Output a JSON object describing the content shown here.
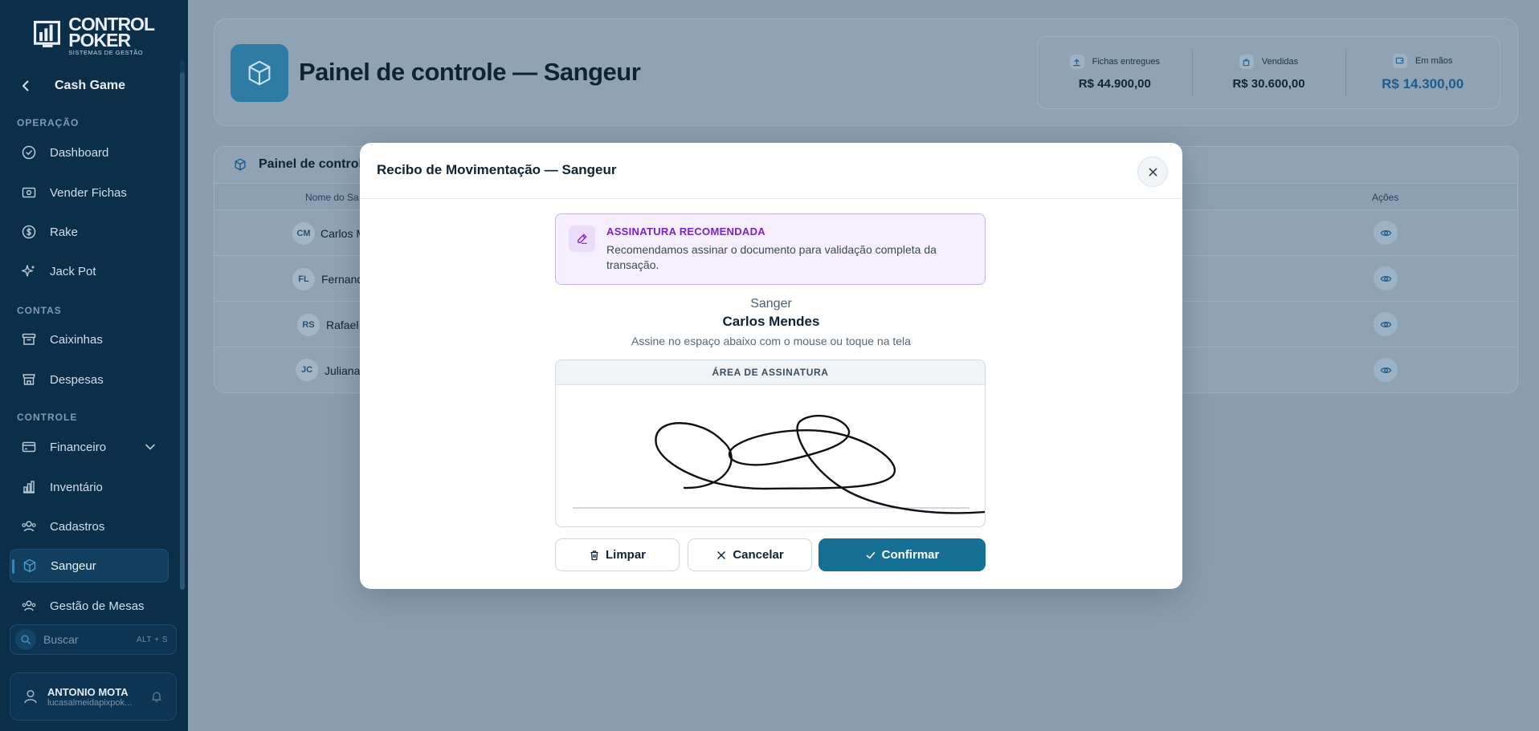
{
  "app": {
    "logo_line1": "CONTROL",
    "logo_line2": "POKER",
    "logo_line3": "SISTEMAS DE GESTÃO",
    "back_title": "Cash Game"
  },
  "sidebar": {
    "sections": {
      "operacao": "OPERAÇÃO",
      "contas": "CONTAS",
      "controle": "CONTROLE"
    },
    "items": [
      {
        "label": "Dashboard",
        "icon": "check-circle-icon"
      },
      {
        "label": "Vender Fichas",
        "icon": "cash-icon"
      },
      {
        "label": "Rake",
        "icon": "dollar-circle-icon"
      },
      {
        "label": "Jack Pot",
        "icon": "sparkles-icon"
      },
      {
        "label": "Caixinhas",
        "icon": "archive-icon"
      },
      {
        "label": "Despesas",
        "icon": "store-icon"
      },
      {
        "label": "Financeiro",
        "icon": "wallet-icon"
      },
      {
        "label": "Inventário",
        "icon": "bar-chart-icon"
      },
      {
        "label": "Cadastros",
        "icon": "users-icon"
      },
      {
        "label": "Sangeur",
        "icon": "cube-icon"
      },
      {
        "label": "Gestão de Mesas",
        "icon": "users-group-icon"
      }
    ],
    "active_item": "Sangeur",
    "search": {
      "placeholder": "Buscar",
      "shortcut": "ALT + S"
    },
    "user": {
      "name": "ANTONIO MOTA",
      "email": "lucasalmeidapixpok..."
    }
  },
  "page": {
    "title": "Painel de controle — Sangeur",
    "stats": [
      {
        "label": "Fichas entregues",
        "value": "R$ 44.900,00"
      },
      {
        "label": "Vendidas",
        "value": "R$ 30.600,00"
      },
      {
        "label": "Em mãos",
        "value": "R$ 14.300,00"
      }
    ],
    "table": {
      "title": "Painel de controle",
      "columns": {
        "name": "Nome do Sa",
        "actions": "Ações"
      },
      "rows": [
        {
          "initials": "CM",
          "name": "Carlos M"
        },
        {
          "initials": "FL",
          "name": "Fernand"
        },
        {
          "initials": "RS",
          "name": "Rafael"
        },
        {
          "initials": "JC",
          "name": "Juliana"
        }
      ]
    }
  },
  "modal": {
    "title": "Recibo de Movimentação — Sangeur",
    "alert": {
      "title": "ASSINATURA RECOMENDADA",
      "text": "Recomendamos assinar o documento para validação completa da transação."
    },
    "role": "Sanger",
    "signer": "Carlos Mendes",
    "hint": "Assine no espaço abaixo com o mouse ou toque na tela",
    "signature_area_label": "ÁREA DE ASSINATURA",
    "buttons": {
      "clear": "Limpar",
      "cancel": "Cancelar",
      "confirm": "Confirmar"
    }
  },
  "colors": {
    "sidebar_bg": "#0b2e49",
    "primary": "#166f94",
    "alert_accent": "#7a23c8",
    "overlay": "#8a9eb0"
  }
}
